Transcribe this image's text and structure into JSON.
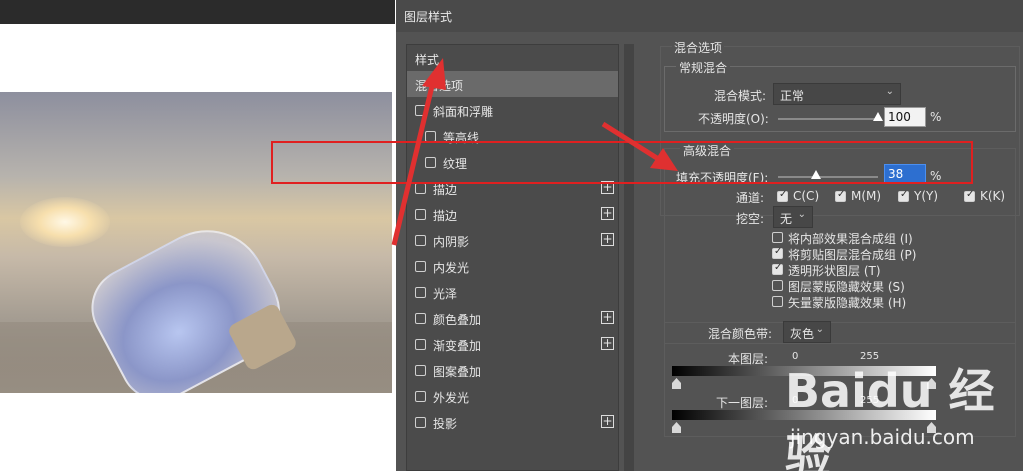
{
  "dialog": {
    "title": "图层样式"
  },
  "style_list": {
    "header": "样式",
    "items": [
      {
        "label": "混合选项",
        "checkbox": false,
        "checked": false,
        "plus": false,
        "indent": 0,
        "active": true
      },
      {
        "label": "斜面和浮雕",
        "checkbox": true,
        "checked": false,
        "plus": false,
        "indent": 0
      },
      {
        "label": "等高线",
        "checkbox": true,
        "checked": false,
        "plus": false,
        "indent": 1
      },
      {
        "label": "纹理",
        "checkbox": true,
        "checked": false,
        "plus": false,
        "indent": 1
      },
      {
        "label": "描边",
        "checkbox": true,
        "checked": false,
        "plus": true,
        "indent": 0
      },
      {
        "label": "描边",
        "checkbox": true,
        "checked": false,
        "plus": true,
        "indent": 0
      },
      {
        "label": "内阴影",
        "checkbox": true,
        "checked": false,
        "plus": true,
        "indent": 0
      },
      {
        "label": "内发光",
        "checkbox": true,
        "checked": false,
        "plus": false,
        "indent": 0
      },
      {
        "label": "光泽",
        "checkbox": true,
        "checked": false,
        "plus": false,
        "indent": 0
      },
      {
        "label": "颜色叠加",
        "checkbox": true,
        "checked": false,
        "plus": true,
        "indent": 0
      },
      {
        "label": "渐变叠加",
        "checkbox": true,
        "checked": false,
        "plus": true,
        "indent": 0
      },
      {
        "label": "图案叠加",
        "checkbox": true,
        "checked": false,
        "plus": false,
        "indent": 0
      },
      {
        "label": "外发光",
        "checkbox": true,
        "checked": false,
        "plus": false,
        "indent": 0
      },
      {
        "label": "投影",
        "checkbox": true,
        "checked": false,
        "plus": true,
        "indent": 0
      }
    ]
  },
  "blend": {
    "section_title": "混合选项",
    "general": {
      "title": "常规混合",
      "mode_label": "混合模式:",
      "mode_value": "正常",
      "opacity_label": "不透明度(O):",
      "opacity_value": "100",
      "opacity_level": 1.0,
      "unit": "%"
    },
    "advanced": {
      "title": "高级混合",
      "fill_label": "填充不透明度(F):",
      "fill_value": "38",
      "fill_level": 0.38,
      "unit": "%",
      "channels_label": "通道:",
      "channels": [
        {
          "label": "C(C)",
          "checked": true
        },
        {
          "label": "M(M)",
          "checked": true
        },
        {
          "label": "Y(Y)",
          "checked": true
        },
        {
          "label": "K(K)",
          "checked": true
        }
      ],
      "knockout_label": "挖空:",
      "knockout_value": "无",
      "options": [
        {
          "label": "将内部效果混合成组 (I)",
          "checked": false
        },
        {
          "label": "将剪贴图层混合成组 (P)",
          "checked": true
        },
        {
          "label": "透明形状图层 (T)",
          "checked": true
        },
        {
          "label": "图层蒙版隐藏效果 (S)",
          "checked": false
        },
        {
          "label": "矢量蒙版隐藏效果 (H)",
          "checked": false
        }
      ]
    },
    "blend_if": {
      "label": "混合颜色带:",
      "value": "灰色",
      "this_layer_label": "本图层:",
      "this_layer_min": "0",
      "this_layer_max": "255",
      "underlying_label": "下一图层:",
      "underlying_min": "0",
      "underlying_max": "255"
    }
  },
  "watermark": {
    "logo": "Baidu 经验",
    "url": "jingyan.baidu.com"
  },
  "colors": {
    "dialog_bg": "#535353",
    "highlight_box": "#e02020",
    "arrow": "#e03030",
    "focus_input": "#2d6fd0"
  }
}
